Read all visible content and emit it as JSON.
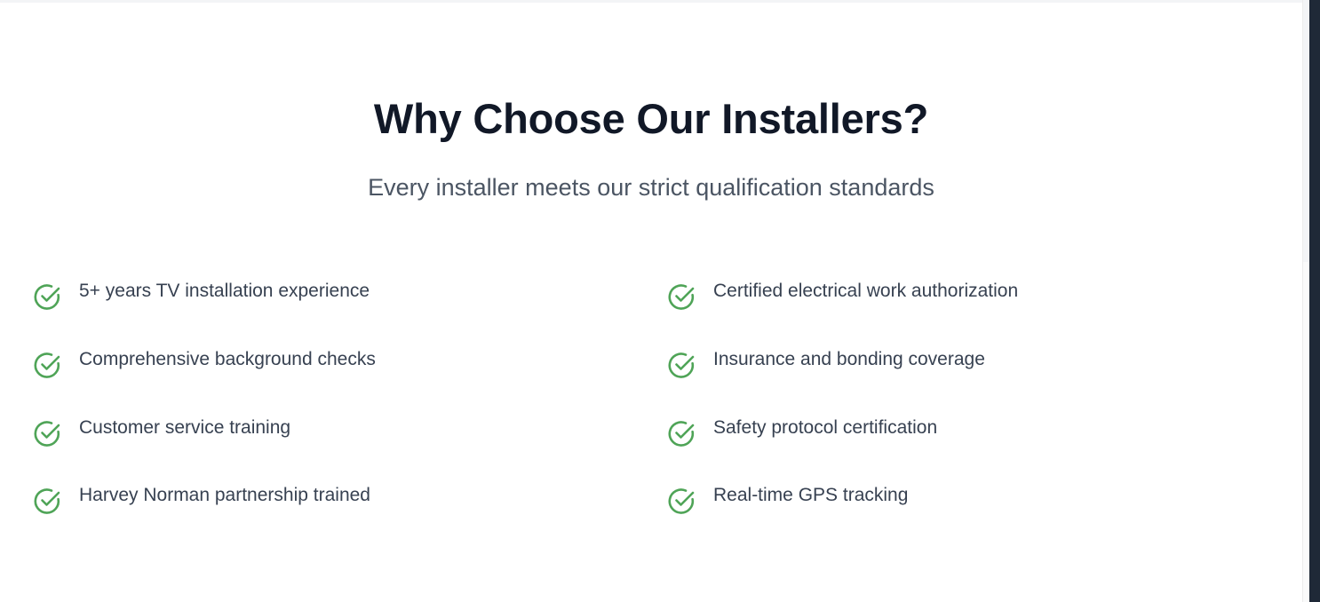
{
  "section": {
    "title": "Why Choose Our Installers?",
    "subtitle": "Every installer meets our strict qualification standards"
  },
  "theme": {
    "check_color": "#4fa457",
    "title_color": "#111827",
    "text_color": "#374151"
  },
  "features": {
    "left": [
      {
        "label": "5+ years TV installation experience",
        "icon": "check-circle-icon"
      },
      {
        "label": "Comprehensive background checks",
        "icon": "check-circle-icon"
      },
      {
        "label": "Customer service training",
        "icon": "check-circle-icon"
      },
      {
        "label": "Harvey Norman partnership trained",
        "icon": "check-circle-icon"
      }
    ],
    "right": [
      {
        "label": "Certified electrical work authorization",
        "icon": "check-circle-icon"
      },
      {
        "label": "Insurance and bonding coverage",
        "icon": "check-circle-icon"
      },
      {
        "label": "Safety protocol certification",
        "icon": "check-circle-icon"
      },
      {
        "label": "Real-time GPS tracking",
        "icon": "check-circle-icon"
      }
    ]
  }
}
